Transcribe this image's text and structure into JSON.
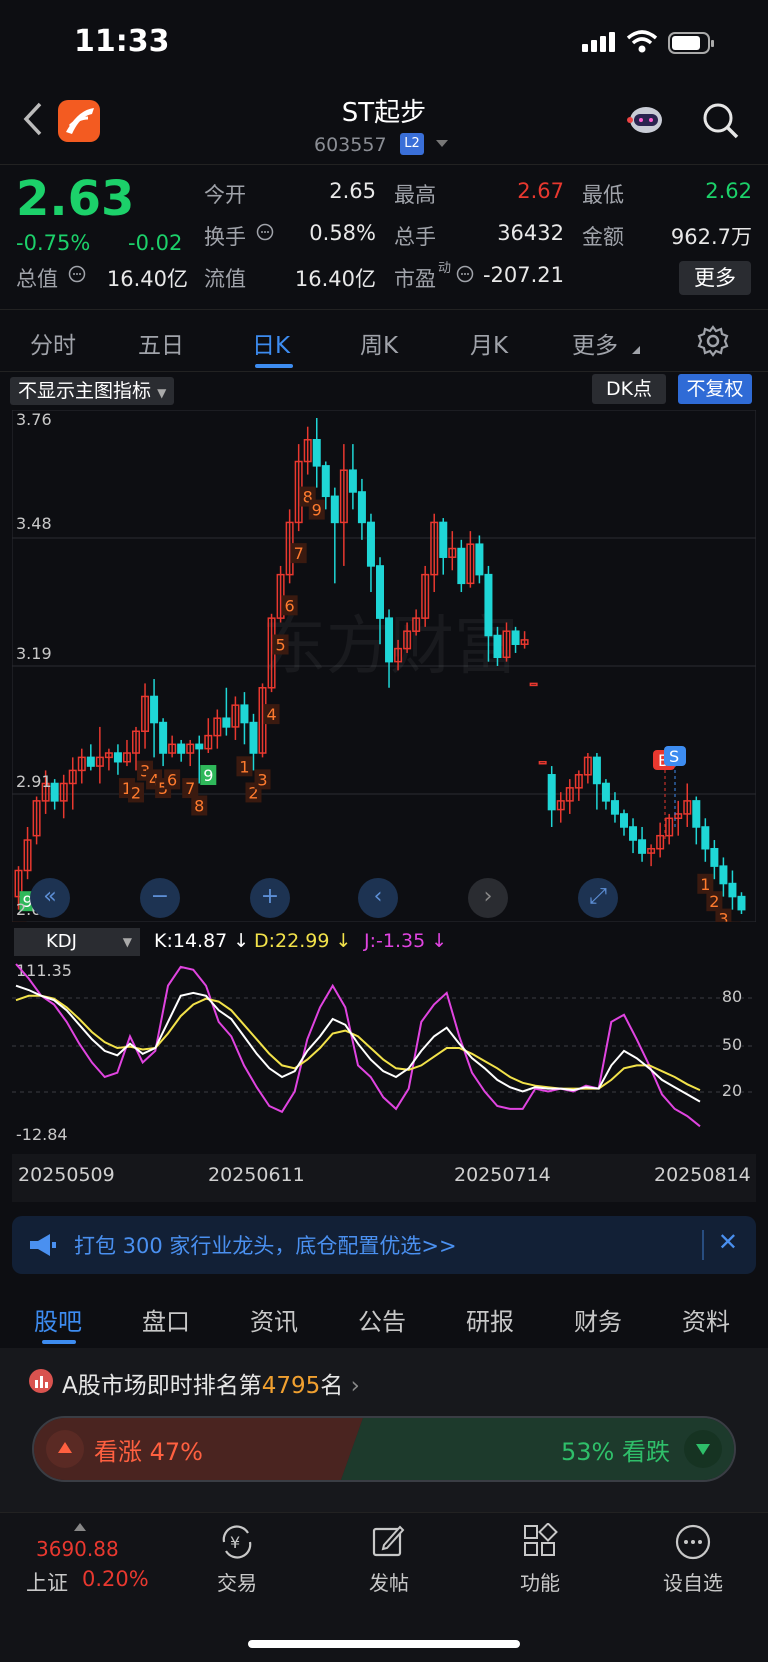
{
  "status": {
    "time": "11:33"
  },
  "header": {
    "title": "ST起步",
    "code": "603557",
    "level_badge": "L2"
  },
  "quote": {
    "price": "2.63",
    "pct": "-0.75%",
    "change": "-0.02",
    "fields": [
      {
        "label": "今开",
        "value": "2.65"
      },
      {
        "label": "最高",
        "value": "2.67"
      },
      {
        "label": "最低",
        "value": "2.62"
      },
      {
        "label": "换手",
        "value": "0.58%"
      },
      {
        "label": "总手",
        "value": "36432"
      },
      {
        "label": "金额",
        "value": "962.7万"
      },
      {
        "label": "总值",
        "value": "16.40亿"
      },
      {
        "label": "流值",
        "value": "16.40亿"
      },
      {
        "label": "市盈",
        "sup": "动",
        "value": "-207.21"
      }
    ],
    "more": "更多"
  },
  "period_tabs": [
    "分时",
    "五日",
    "日K",
    "周K",
    "月K",
    "更多"
  ],
  "indicator_bar": {
    "main_indicator": "不显示主图指标",
    "dk": "DK点",
    "adjust": "不复权"
  },
  "chart_data": {
    "type": "candlestick",
    "price_labels": [
      "3.76",
      "3.48",
      "3.19",
      "2.91",
      "2.62"
    ],
    "ylim": [
      2.62,
      3.76
    ],
    "dates": [
      "20250509",
      "20250611",
      "20250714",
      "20250814"
    ],
    "watermark": "东方财富",
    "candles": [
      [
        2.66,
        2.72,
        2.63,
        2.73
      ],
      [
        2.72,
        2.79,
        2.7,
        2.82
      ],
      [
        2.8,
        2.88,
        2.78,
        2.89
      ],
      [
        2.88,
        2.92,
        2.85,
        2.95
      ],
      [
        2.92,
        2.88,
        2.86,
        2.93
      ],
      [
        2.88,
        2.92,
        2.84,
        2.94
      ],
      [
        2.92,
        2.95,
        2.86,
        2.98
      ],
      [
        2.95,
        2.98,
        2.92,
        3.0
      ],
      [
        2.98,
        2.96,
        2.95,
        3.01
      ],
      [
        2.96,
        2.98,
        2.92,
        3.05
      ],
      [
        2.98,
        2.99,
        2.95,
        3.0
      ],
      [
        2.99,
        2.97,
        2.94,
        3.01
      ],
      [
        2.97,
        2.99,
        2.96,
        3.02
      ],
      [
        2.99,
        3.04,
        2.95,
        3.05
      ],
      [
        3.04,
        3.12,
        3.0,
        3.15
      ],
      [
        3.12,
        3.06,
        2.98,
        3.16
      ],
      [
        3.06,
        2.99,
        2.96,
        3.07
      ],
      [
        2.99,
        3.01,
        2.98,
        3.03
      ],
      [
        3.01,
        2.99,
        2.97,
        3.02
      ],
      [
        2.99,
        3.01,
        2.96,
        3.02
      ],
      [
        3.01,
        3.0,
        2.92,
        3.03
      ],
      [
        3.0,
        3.03,
        2.99,
        3.07
      ],
      [
        3.03,
        3.07,
        3.0,
        3.09
      ],
      [
        3.07,
        3.05,
        3.03,
        3.14
      ],
      [
        3.05,
        3.1,
        3.02,
        3.12
      ],
      [
        3.1,
        3.06,
        3.01,
        3.13
      ],
      [
        3.06,
        2.99,
        2.95,
        3.08
      ],
      [
        2.99,
        3.14,
        2.98,
        3.15
      ],
      [
        3.14,
        3.3,
        3.13,
        3.31
      ],
      [
        3.3,
        3.4,
        3.29,
        3.42
      ],
      [
        3.4,
        3.52,
        3.38,
        3.55
      ],
      [
        3.52,
        3.66,
        3.5,
        3.7
      ],
      [
        3.66,
        3.71,
        3.63,
        3.74
      ],
      [
        3.71,
        3.65,
        3.6,
        3.76
      ],
      [
        3.65,
        3.58,
        3.55,
        3.66
      ],
      [
        3.58,
        3.52,
        3.38,
        3.6
      ],
      [
        3.52,
        3.64,
        3.42,
        3.7
      ],
      [
        3.64,
        3.59,
        3.55,
        3.7
      ],
      [
        3.59,
        3.52,
        3.48,
        3.62
      ],
      [
        3.52,
        3.42,
        3.36,
        3.54
      ],
      [
        3.42,
        3.3,
        3.24,
        3.44
      ],
      [
        3.3,
        3.2,
        3.14,
        3.32
      ],
      [
        3.2,
        3.23,
        3.18,
        3.25
      ],
      [
        3.23,
        3.27,
        3.22,
        3.29
      ],
      [
        3.27,
        3.3,
        3.26,
        3.32
      ],
      [
        3.3,
        3.4,
        3.28,
        3.42
      ],
      [
        3.4,
        3.52,
        3.36,
        3.54
      ],
      [
        3.52,
        3.44,
        3.4,
        3.53
      ],
      [
        3.44,
        3.46,
        3.41,
        3.5
      ],
      [
        3.46,
        3.38,
        3.36,
        3.48
      ],
      [
        3.38,
        3.47,
        3.37,
        3.5
      ],
      [
        3.47,
        3.4,
        3.38,
        3.49
      ],
      [
        3.4,
        3.26,
        3.2,
        3.42
      ],
      [
        3.26,
        3.21,
        3.19,
        3.28
      ],
      [
        3.21,
        3.27,
        3.2,
        3.29
      ],
      [
        3.27,
        3.24,
        3.22,
        3.28
      ],
      [
        3.24,
        3.25,
        3.23,
        3.27
      ],
      [
        3.15,
        3.15,
        3.15,
        3.15
      ],
      [
        2.97,
        2.97,
        2.97,
        2.97
      ],
      [
        2.94,
        2.86,
        2.82,
        2.96
      ],
      [
        2.86,
        2.88,
        2.83,
        2.9
      ],
      [
        2.88,
        2.91,
        2.85,
        2.93
      ],
      [
        2.91,
        2.94,
        2.88,
        2.95
      ],
      [
        2.94,
        2.98,
        2.92,
        2.99
      ],
      [
        2.98,
        2.92,
        2.86,
        2.99
      ],
      [
        2.92,
        2.88,
        2.86,
        2.93
      ],
      [
        2.88,
        2.85,
        2.83,
        2.9
      ],
      [
        2.85,
        2.82,
        2.8,
        2.86
      ],
      [
        2.82,
        2.79,
        2.76,
        2.84
      ],
      [
        2.79,
        2.76,
        2.74,
        2.82
      ],
      [
        2.76,
        2.77,
        2.73,
        2.78
      ],
      [
        2.77,
        2.8,
        2.75,
        2.83
      ],
      [
        2.8,
        2.84,
        2.78,
        2.85
      ],
      [
        2.84,
        2.85,
        2.8,
        2.88
      ],
      [
        2.85,
        2.88,
        2.82,
        2.92
      ],
      [
        2.88,
        2.82,
        2.78,
        2.89
      ],
      [
        2.82,
        2.77,
        2.74,
        2.84
      ],
      [
        2.77,
        2.73,
        2.7,
        2.79
      ],
      [
        2.73,
        2.69,
        2.66,
        2.75
      ],
      [
        2.69,
        2.66,
        2.63,
        2.72
      ],
      [
        2.66,
        2.63,
        2.62,
        2.67
      ]
    ],
    "markers": [
      {
        "i": 0,
        "text": "8"
      },
      {
        "i": 1,
        "text": "9",
        "green": true
      },
      {
        "i": 12,
        "text": "1"
      },
      {
        "i": 13,
        "text": "2"
      },
      {
        "i": 14,
        "text": "3"
      },
      {
        "i": 15,
        "text": "4"
      },
      {
        "i": 16,
        "text": "5"
      },
      {
        "i": 17,
        "text": "6"
      },
      {
        "i": 19,
        "text": "7"
      },
      {
        "i": 20,
        "text": "8"
      },
      {
        "i": 21,
        "text": "9",
        "green": true
      },
      {
        "i": 25,
        "text": "1"
      },
      {
        "i": 26,
        "text": "2"
      },
      {
        "i": 27,
        "text": "3"
      },
      {
        "i": 28,
        "text": "4"
      },
      {
        "i": 29,
        "text": "5"
      },
      {
        "i": 30,
        "text": "6"
      },
      {
        "i": 31,
        "text": "7"
      },
      {
        "i": 32,
        "text": "8"
      },
      {
        "i": 33,
        "text": "9"
      },
      {
        "i": 76,
        "text": "1"
      },
      {
        "i": 77,
        "text": "2"
      },
      {
        "i": 78,
        "text": "3"
      },
      {
        "i": 79,
        "text": "4"
      },
      {
        "i": 78,
        "text": "5"
      },
      {
        "i": 79,
        "text": "6"
      },
      {
        "i": 80,
        "text": "7"
      }
    ]
  },
  "kdj": {
    "name": "KDJ",
    "k": "K:14.87",
    "d": "D:22.99",
    "j": "J:-1.35",
    "top": "111.35",
    "bottom": "-12.84",
    "levels": [
      "80",
      "50",
      "20"
    ],
    "ylim": [
      -12.84,
      111.35
    ],
    "K": [
      95,
      92,
      88,
      85,
      78,
      68,
      58,
      50,
      47,
      55,
      48,
      52,
      70,
      88,
      90,
      88,
      78,
      72,
      60,
      48,
      38,
      32,
      36,
      50,
      60,
      72,
      68,
      55,
      44,
      36,
      32,
      38,
      50,
      60,
      66,
      55,
      45,
      38,
      30,
      25,
      22,
      25,
      24,
      24,
      23,
      25,
      24,
      40,
      50,
      45,
      38,
      30,
      25,
      20,
      15
    ],
    "D": [
      85,
      88,
      88,
      86,
      80,
      72,
      63,
      56,
      52,
      53,
      51,
      52,
      62,
      74,
      82,
      86,
      84,
      78,
      68,
      58,
      48,
      40,
      38,
      44,
      52,
      62,
      64,
      60,
      52,
      44,
      38,
      37,
      40,
      46,
      52,
      52,
      48,
      43,
      38,
      32,
      28,
      26,
      25,
      24,
      24,
      24,
      24,
      30,
      38,
      40,
      40,
      36,
      32,
      27,
      23
    ],
    "J": [
      110,
      100,
      88,
      82,
      70,
      55,
      42,
      32,
      35,
      60,
      42,
      50,
      95,
      108,
      106,
      95,
      70,
      60,
      40,
      25,
      12,
      8,
      22,
      58,
      80,
      95,
      80,
      40,
      32,
      18,
      10,
      24,
      70,
      82,
      90,
      60,
      35,
      22,
      12,
      10,
      10,
      24,
      22,
      24,
      22,
      26,
      24,
      70,
      75,
      58,
      40,
      20,
      10,
      5,
      -2
    ]
  },
  "banner": {
    "text": "打包 300 家行业龙头，底仓配置优选>>",
    "close": "✕"
  },
  "content_tabs": [
    "股吧",
    "盘口",
    "资讯",
    "公告",
    "研报",
    "财务",
    "资料"
  ],
  "ranking": {
    "prefix": "A股市场即时排名第",
    "rank": "4795",
    "suffix": "名"
  },
  "vote": {
    "up_label": "看涨",
    "up_pct": "47%",
    "down_label": "看跌",
    "down_pct": "53%",
    "up_fraction": 0.47
  },
  "bottom_nav": {
    "index_value": "3690.88",
    "index_name": "上证",
    "index_pct": "0.20%",
    "items": [
      "交易",
      "发帖",
      "功能",
      "设自选"
    ]
  },
  "colors": {
    "up": "#e8382f",
    "down": "#1fd6d6",
    "green": "#1cd16a",
    "accent": "#3d8cf0"
  }
}
